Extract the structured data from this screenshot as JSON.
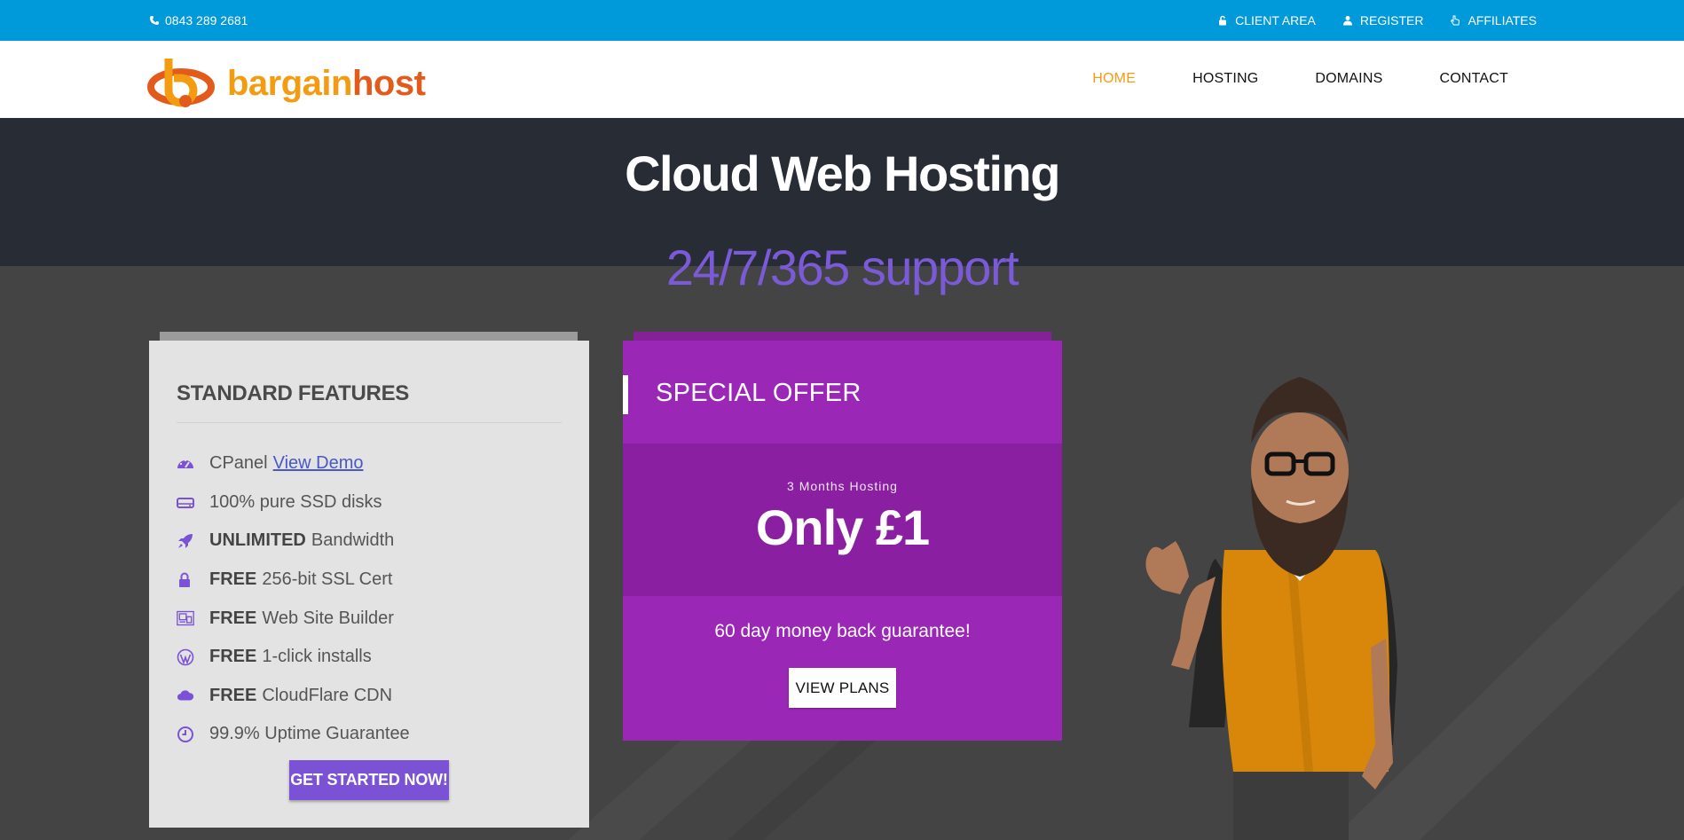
{
  "topbar": {
    "phone": "0843 289 2681",
    "links": [
      {
        "label": "CLIENT AREA",
        "icon": "lock-open-icon"
      },
      {
        "label": "REGISTER",
        "icon": "user-icon"
      },
      {
        "label": "AFFILIATES",
        "icon": "hand-pointer-icon"
      }
    ]
  },
  "brand": {
    "part1": "bargain",
    "part2": "host"
  },
  "nav": {
    "items": [
      {
        "label": "HOME",
        "active": true
      },
      {
        "label": "HOSTING",
        "active": false
      },
      {
        "label": "DOMAINS",
        "active": false
      },
      {
        "label": "CONTACT",
        "active": false
      }
    ]
  },
  "hero": {
    "title": "Cloud Web Hosting",
    "subtitle": "24/7/365 support"
  },
  "features": {
    "heading": "STANDARD FEATURES",
    "items": [
      {
        "bold": "",
        "text": "CPanel",
        "link": "View Demo",
        "icon": "dashboard-icon"
      },
      {
        "bold": "",
        "text": "100% pure SSD disks",
        "link": "",
        "icon": "hard-drive-icon"
      },
      {
        "bold": "UNLIMITED",
        "text": "Bandwidth",
        "link": "",
        "icon": "rocket-icon"
      },
      {
        "bold": "FREE",
        "text": "256-bit SSL Cert",
        "link": "",
        "icon": "lock-icon"
      },
      {
        "bold": "FREE",
        "text": "Web Site Builder",
        "link": "",
        "icon": "site-builder-icon"
      },
      {
        "bold": "FREE",
        "text": "1-click installs",
        "link": "",
        "icon": "wordpress-icon"
      },
      {
        "bold": "FREE",
        "text": "CloudFlare CDN",
        "link": "",
        "icon": "cloud-icon"
      },
      {
        "bold": "",
        "text": "99.9% Uptime Guarantee",
        "link": "",
        "icon": "clock-icon"
      }
    ],
    "cta": "GET STARTED NOW!"
  },
  "offer": {
    "heading": "SPECIAL OFFER",
    "small": "3 Months Hosting",
    "price": "Only £1",
    "guarantee": "60 day money back guarantee!",
    "cta": "VIEW PLANS"
  },
  "colors": {
    "topbar": "#0099d9",
    "nav_active": "#f39c12",
    "hero_dark": "#272c35",
    "accent_purple": "#7b52d6",
    "offer_purple": "#9b27b6"
  }
}
